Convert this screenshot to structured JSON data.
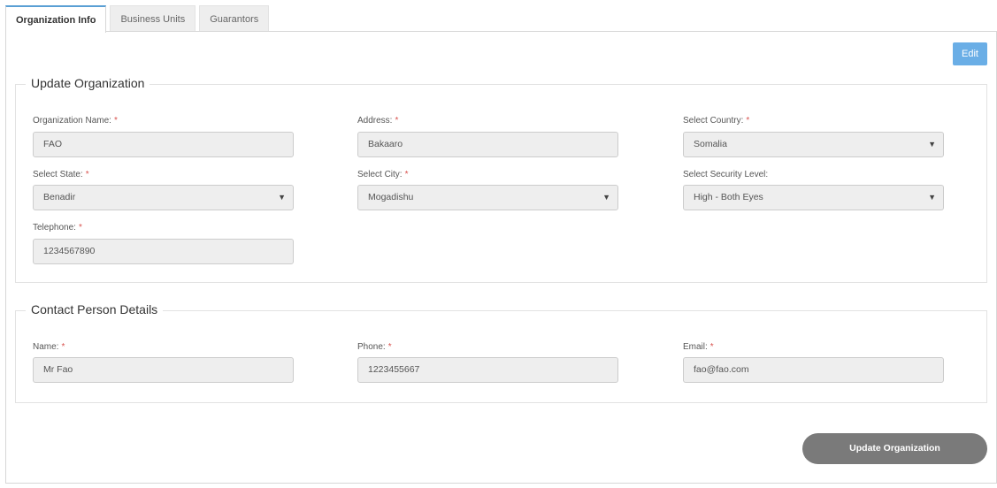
{
  "tabs": [
    {
      "label": "Organization Info",
      "active": true
    },
    {
      "label": "Business Units",
      "active": false
    },
    {
      "label": "Guarantors",
      "active": false
    }
  ],
  "edit_label": "Edit",
  "org_section": {
    "title": "Update Organization",
    "org_name": {
      "label": "Organization Name:",
      "value": "FAO"
    },
    "address": {
      "label": "Address:",
      "value": "Bakaaro"
    },
    "country": {
      "label": "Select Country:",
      "value": "Somalia"
    },
    "state": {
      "label": "Select State:",
      "value": "Benadir"
    },
    "city": {
      "label": "Select City:",
      "value": "Mogadishu"
    },
    "security": {
      "label": "Select Security Level:",
      "value": "High - Both Eyes"
    },
    "telephone": {
      "label": "Telephone:",
      "value": "1234567890"
    }
  },
  "contact_section": {
    "title": "Contact Person Details",
    "name": {
      "label": "Name:",
      "value": "Mr Fao"
    },
    "phone": {
      "label": "Phone:",
      "value": "1223455667"
    },
    "email": {
      "label": "Email:",
      "value": "fao@fao.com"
    }
  },
  "required_mark": "*",
  "caret_glyph": "▼",
  "update_label": "Update Organization",
  "colors": {
    "accent": "#5a9fd4",
    "edit_button": "#6aaee6",
    "required": "#d9534f",
    "update_button": "#7a7a7a"
  }
}
